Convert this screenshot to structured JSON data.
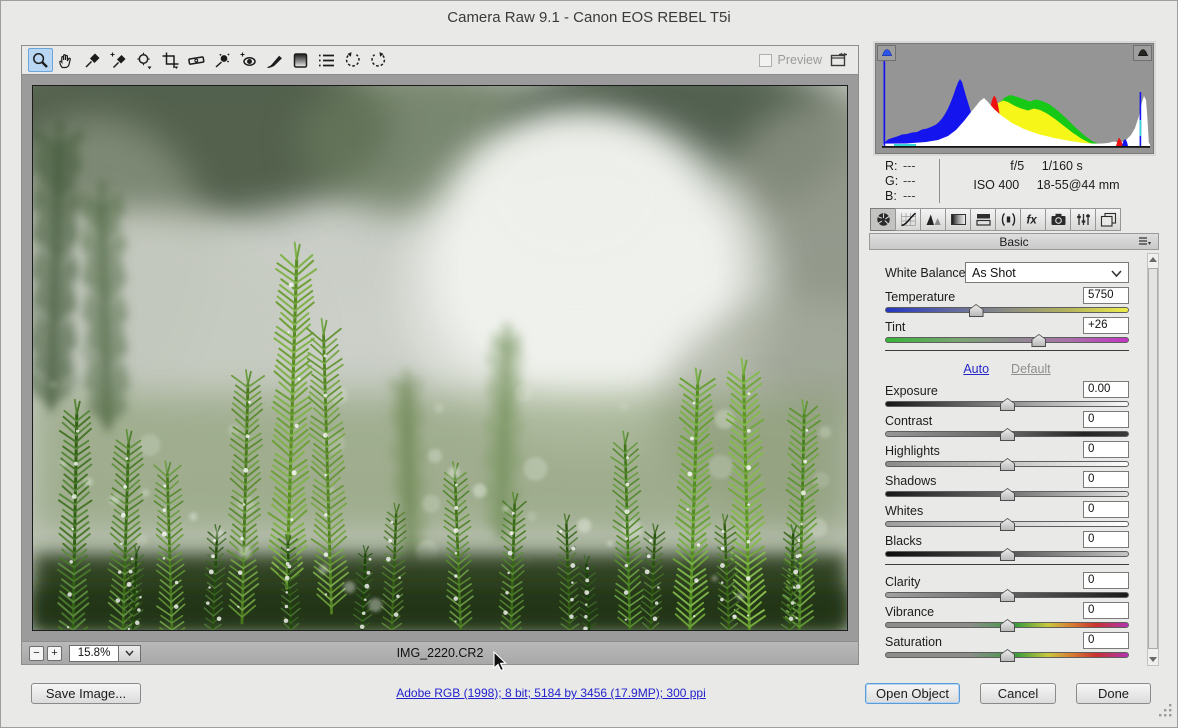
{
  "window": {
    "title": "Camera Raw 9.1  -  Canon EOS REBEL T5i"
  },
  "toolbar": {
    "preview_label": "Preview",
    "tools": [
      {
        "name": "zoom-tool",
        "selected": true
      },
      {
        "name": "hand-tool",
        "selected": false
      },
      {
        "name": "white-balance-tool",
        "selected": false
      },
      {
        "name": "color-sampler-tool",
        "selected": false
      },
      {
        "name": "targeted-adjustment-tool",
        "selected": false
      },
      {
        "name": "crop-tool",
        "selected": false
      },
      {
        "name": "straighten-tool",
        "selected": false
      },
      {
        "name": "spot-removal-tool",
        "selected": false
      },
      {
        "name": "red-eye-removal-tool",
        "selected": false
      },
      {
        "name": "adjustment-brush-tool",
        "selected": false
      },
      {
        "name": "graduated-filter-tool",
        "selected": false
      },
      {
        "name": "preferences-tool",
        "selected": false
      },
      {
        "name": "rotate-left-tool",
        "selected": false
      },
      {
        "name": "rotate-right-tool",
        "selected": false
      }
    ]
  },
  "histogram": {
    "rgb_rows": [
      {
        "label": "R:",
        "value": "---"
      },
      {
        "label": "G:",
        "value": "---"
      },
      {
        "label": "B:",
        "value": "---"
      }
    ],
    "exif": {
      "aperture": "f/5",
      "shutter": "1/160 s",
      "iso": "ISO 400",
      "lens": "18-55@44 mm"
    }
  },
  "panel": {
    "header": "Basic",
    "tabs": [
      "tab-basic",
      "tab-tone-curve",
      "tab-detail",
      "tab-hsl-grayscale",
      "tab-split-toning",
      "tab-lens-corrections",
      "tab-effects",
      "tab-camera-calibration",
      "tab-presets",
      "tab-snapshots"
    ],
    "white_balance_label": "White Balance:",
    "white_balance_value": "As Shot",
    "auto_link": "Auto",
    "default_link": "Default",
    "rows": [
      {
        "type": "slider",
        "label": "Temperature",
        "value": "5750",
        "track": "temp",
        "pos": 37
      },
      {
        "type": "slider",
        "label": "Tint",
        "value": "+26",
        "track": "tint",
        "pos": 63
      },
      {
        "type": "sep"
      },
      {
        "type": "links"
      },
      {
        "type": "slider",
        "label": "Exposure",
        "value": "0.00",
        "track": "exposure",
        "pos": 50
      },
      {
        "type": "slider",
        "label": "Contrast",
        "value": "0",
        "track": "contrast",
        "pos": 50
      },
      {
        "type": "slider",
        "label": "Highlights",
        "value": "0",
        "track": "highlights",
        "pos": 50
      },
      {
        "type": "slider",
        "label": "Shadows",
        "value": "0",
        "track": "shadows",
        "pos": 50
      },
      {
        "type": "slider",
        "label": "Whites",
        "value": "0",
        "track": "whites",
        "pos": 50
      },
      {
        "type": "slider",
        "label": "Blacks",
        "value": "0",
        "track": "blacks",
        "pos": 50
      },
      {
        "type": "sep"
      },
      {
        "type": "slider",
        "label": "Clarity",
        "value": "0",
        "track": "clarity",
        "pos": 50
      },
      {
        "type": "slider",
        "label": "Vibrance",
        "value": "0",
        "track": "vibrance",
        "pos": 50
      },
      {
        "type": "slider",
        "label": "Saturation",
        "value": "0",
        "track": "saturation",
        "pos": 50
      }
    ]
  },
  "statusbar": {
    "zoom_level": "15.8%",
    "filename": "IMG_2220.CR2"
  },
  "footer": {
    "save_button": "Save Image...",
    "workflow_link": "Adobe RGB (1998); 8 bit; 5184 by 3456 (17.9MP); 300 ppi",
    "open_button": "Open Object",
    "cancel_button": "Cancel",
    "done_button": "Done"
  }
}
